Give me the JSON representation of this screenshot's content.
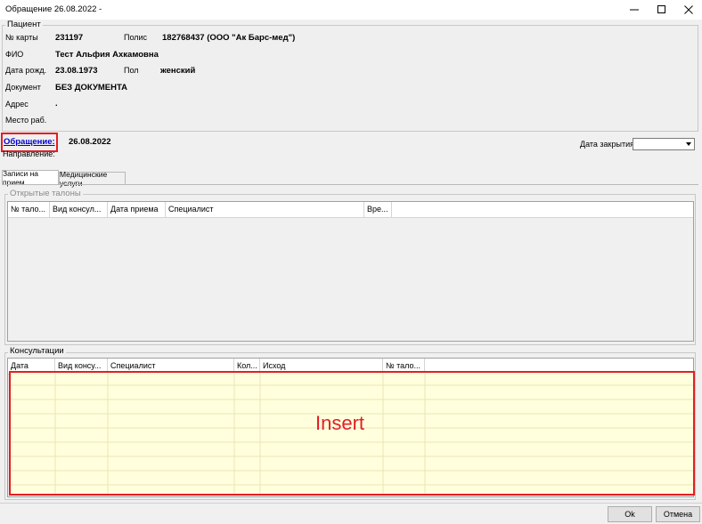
{
  "window": {
    "title": "Обращение 26.08.2022 -"
  },
  "patient": {
    "legend": "Пациент",
    "card_label": "№ карты",
    "card_value": "231197",
    "policy_label": "Полис",
    "policy_value": "182768437 (ООО \"Ак Барс-мед\")",
    "fio_label": "ФИО",
    "fio_value": "Тест Альфия Ахкамовна",
    "dob_label": "Дата рожд.",
    "dob_value": "23.08.1973",
    "sex_label": "Пол",
    "sex_value": "женский",
    "doc_label": "Документ",
    "doc_value": "БЕЗ ДОКУМЕНТА",
    "address_label": "Адрес",
    "address_value": ".",
    "work_label": "Место раб."
  },
  "appeal": {
    "link_label": "Обращение:",
    "date": "26.08.2022",
    "direction_label": "Направление:",
    "close_date_label": "Дата закрытия",
    "close_date_value": ""
  },
  "tabs": [
    {
      "label": "Записи на прием",
      "active": true
    },
    {
      "label": "Медицинские услуги",
      "active": false
    }
  ],
  "open_tickets": {
    "legend": "Открытые талоны",
    "columns": [
      "№ тало...",
      "Вид консул...",
      "Дата приема",
      "Специалист",
      "Вре..."
    ]
  },
  "consultations": {
    "legend": "Консультации",
    "columns": [
      "Дата",
      "Вид консу...",
      "Специалист",
      "Кол...",
      "Исход",
      "№ тало..."
    ],
    "overlay_text": "Insert",
    "highlight_color": "#ffffdd",
    "annotation_color": "#e31e24"
  },
  "buttons": {
    "ok": "Ok",
    "cancel": "Отмена"
  }
}
